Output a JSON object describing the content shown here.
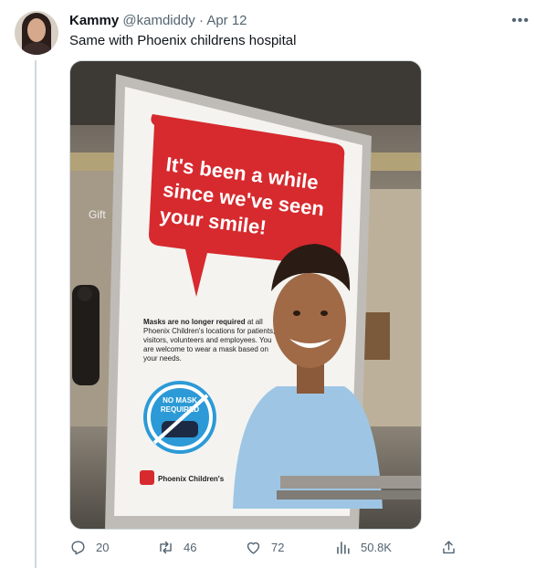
{
  "tweet": {
    "author_name": "Kammy",
    "author_handle": "@kamdiddy",
    "separator": "·",
    "date": "Apr 12",
    "text": "Same with Phoenix childrens hospital"
  },
  "image": {
    "sign": {
      "bubble_text": "It's been a while since we've seen your smile!",
      "body_bold": "Masks are no longer required",
      "body_rest": " at all Phoenix Children's locations for patients, visitors, volunteers and employees. You are welcome to wear a mask based on your needs.",
      "badge_line1": "NO MASK",
      "badge_line2": "REQUIRED",
      "logo_text": "Phoenix Children's"
    },
    "background_text": "Gift"
  },
  "actions": {
    "reply_count": "20",
    "retweet_count": "46",
    "like_count": "72",
    "views_count": "50.8K"
  },
  "icons": {
    "more": "more-icon",
    "reply": "reply-icon",
    "retweet": "retweet-icon",
    "like": "heart-icon",
    "views": "views-icon",
    "share": "share-icon"
  },
  "colors": {
    "text_primary": "#0f1419",
    "text_secondary": "#536471",
    "sign_red": "#d62a2e",
    "badge_blue": "#2c9ad6"
  }
}
